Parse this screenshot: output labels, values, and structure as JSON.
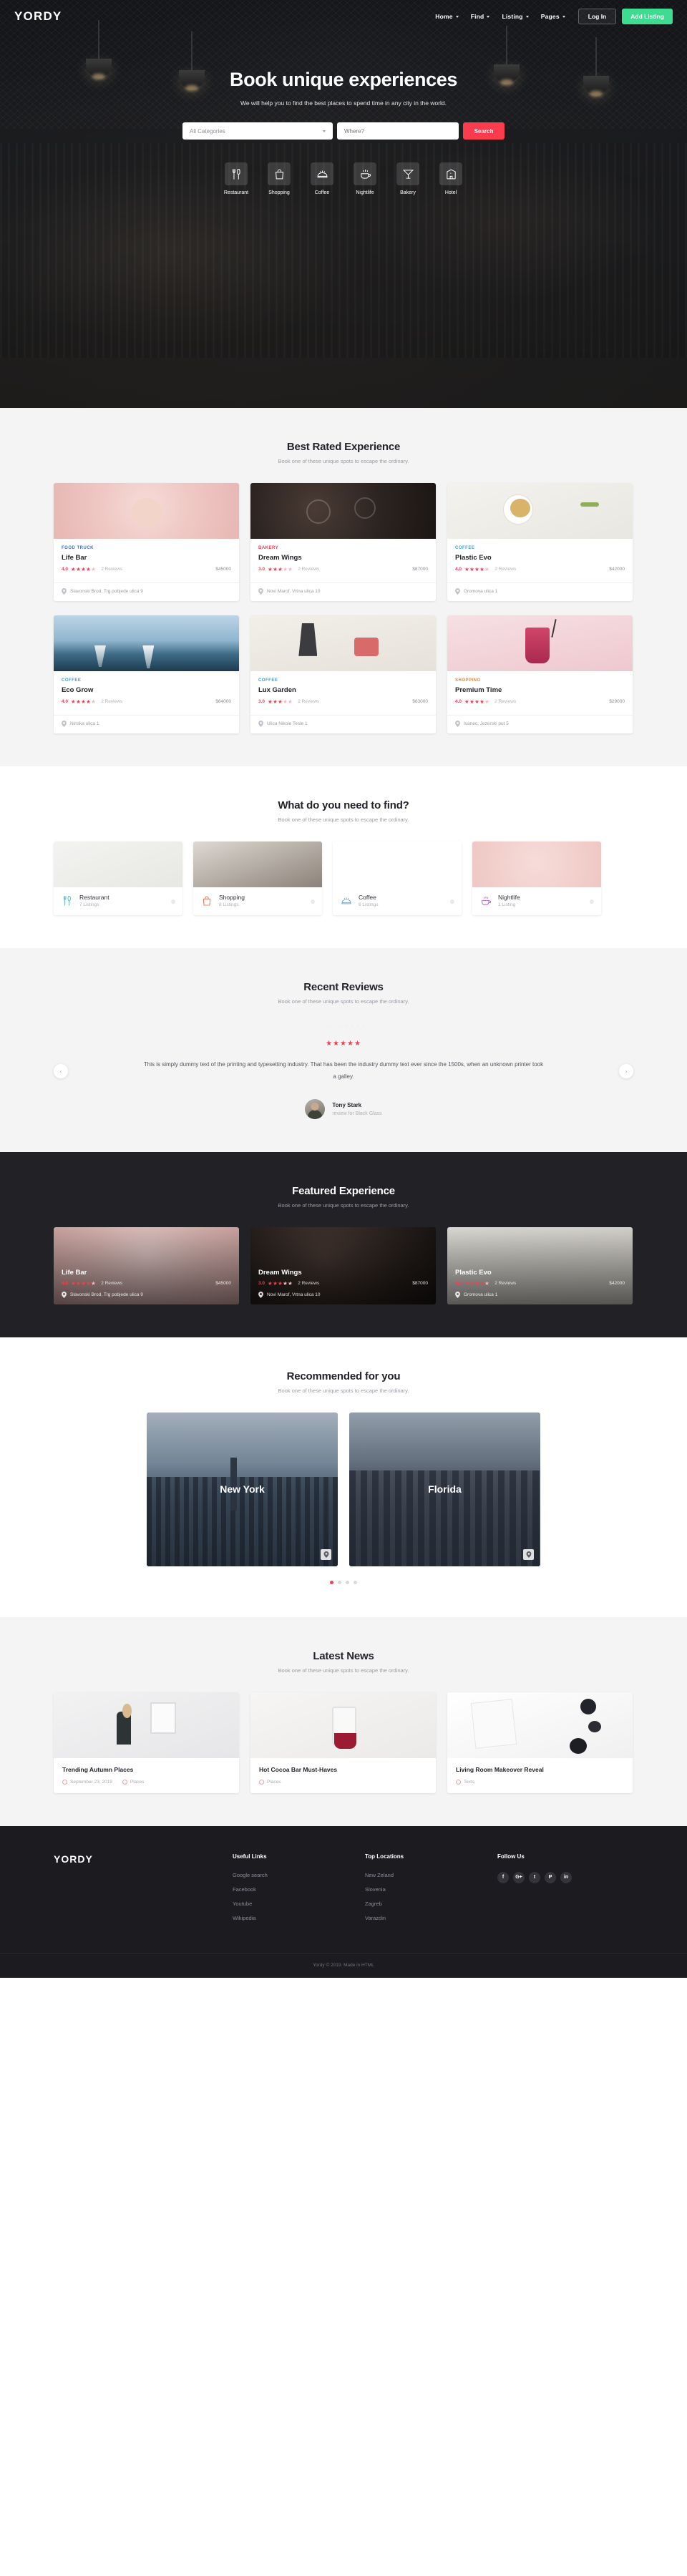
{
  "brand": {
    "name": "YORDY"
  },
  "nav": {
    "links": [
      {
        "label": "Home",
        "caret": true
      },
      {
        "label": "Find",
        "caret": true
      },
      {
        "label": "Listing",
        "caret": true
      },
      {
        "label": "Pages",
        "caret": true
      }
    ],
    "login_label": "Log In",
    "add_listing_label": "Add Listing",
    "accent_green": "#3ddc91"
  },
  "hero": {
    "title": "Book unique experiences",
    "subtitle": "We will help you to find the best places to spend time in any city in the world.",
    "search": {
      "category_value": "All Categories",
      "where_placeholder": "Where?",
      "where_value": "",
      "button_label": "Search",
      "button_color": "#fb3b4e"
    },
    "categories": [
      {
        "label": "Restaurant",
        "icon": "fork-knife-icon"
      },
      {
        "label": "Shopping",
        "icon": "shopping-bag-icon"
      },
      {
        "label": "Coffee",
        "icon": "sandwich-icon"
      },
      {
        "label": "Nightlife",
        "icon": "coffee-cup-icon"
      },
      {
        "label": "Bakery",
        "icon": "cocktail-glass-icon"
      },
      {
        "label": "Hotel",
        "icon": "hotel-building-icon"
      }
    ]
  },
  "best_rated": {
    "title": "Best Rated Experience",
    "subtitle": "Book one of these unique spots to escape the ordinary.",
    "cards": [
      {
        "category": "FOOD TRUCK",
        "category_color": "#3f6fd8",
        "name": "Life Bar",
        "rating": "4.0",
        "stars": 4,
        "reviews": "2 Reviews",
        "price": "$45000",
        "address": "Slavonski Brod, Trg pobjede ulica 9"
      },
      {
        "category": "BAKERY",
        "category_color": "#fb3b4e",
        "name": "Dream Wings",
        "rating": "3.0",
        "stars": 3,
        "reviews": "2 Reviews",
        "price": "$87000",
        "address": "Novi Marof, Vrtna ulica 10"
      },
      {
        "category": "COFFEE",
        "category_color": "#3f9fd8",
        "name": "Plastic Evo",
        "rating": "4.0",
        "stars": 4,
        "reviews": "2 Reviews",
        "price": "$42000",
        "address": "Gromova ulica 1"
      },
      {
        "category": "COFFEE",
        "category_color": "#3f9fd8",
        "name": "Eco Grow",
        "rating": "4.0",
        "stars": 4,
        "reviews": "2 Reviews",
        "price": "$64000",
        "address": "Ninska ulica 1"
      },
      {
        "category": "COFFEE",
        "category_color": "#3f9fd8",
        "name": "Lux Garden",
        "rating": "3.0",
        "stars": 3,
        "reviews": "2 Reviews",
        "price": "$63000",
        "address": "Ulica Nikole Tesle 1"
      },
      {
        "category": "SHOPPING",
        "category_color": "#e8883a",
        "name": "Premium Time",
        "rating": "4.0",
        "stars": 4,
        "reviews": "2 Reviews",
        "price": "$29000",
        "address": "Ivanec, Jezerski put 5"
      }
    ]
  },
  "need_find": {
    "title": "What do you need to find?",
    "subtitle": "Book one of these unique spots to escape the ordinary.",
    "cards": [
      {
        "name": "Restaurant",
        "count": "7 Listings",
        "icon": "fork-knife-icon",
        "color": "#3fb8b8"
      },
      {
        "name": "Shopping",
        "count": "8 Listings",
        "icon": "shopping-bag-icon",
        "color": "#e8663a"
      },
      {
        "name": "Coffee",
        "count": "6 Listings",
        "icon": "sandwich-icon",
        "color": "#4fa3de"
      },
      {
        "name": "Nightlife",
        "count": "1 Listing",
        "icon": "coffee-cup-icon",
        "color": "#a74fd4"
      }
    ]
  },
  "reviews": {
    "title": "Recent Reviews",
    "subtitle": "Book one of these unique spots to escape the ordinary.",
    "stars": 5,
    "text": "This is simply dummy text of the printing and typesetting industry. That has been the industry dummy text ever since the 1500s, when an unknown printer took a galley.",
    "author": "Tony Stark",
    "author_for": "review for Black Glass",
    "prev_icon": "chevron-left-icon",
    "next_icon": "chevron-right-icon"
  },
  "featured": {
    "title": "Featured Experience",
    "subtitle": "Book one of these unique spots to escape the ordinary.",
    "cards": [
      {
        "name": "Life Bar",
        "rating": "4.0",
        "stars": 4,
        "reviews": "2 Reviews",
        "price": "$45000",
        "address": "Slavonski Brod, Trg pobjede ulica 9"
      },
      {
        "name": "Dream Wings",
        "rating": "3.0",
        "stars": 3,
        "reviews": "2 Reviews",
        "price": "$87000",
        "address": "Novi Marof, Vrtna ulica 10"
      },
      {
        "name": "Plastic Evo",
        "rating": "4.0",
        "stars": 4,
        "reviews": "2 Reviews",
        "price": "$42000",
        "address": "Gromova ulica 1"
      }
    ]
  },
  "recommended": {
    "title": "Recommended for you",
    "subtitle": "Book one of these unique spots to escape the ordinary.",
    "cards": [
      {
        "title": "New York",
        "icon": "map-pin-icon"
      },
      {
        "title": "Florida",
        "icon": "map-pin-icon"
      }
    ],
    "dots": 4,
    "active_dot": 0
  },
  "news": {
    "title": "Latest News",
    "subtitle": "Book one of these unique spots to escape the ordinary.",
    "cards": [
      {
        "title": "Trending Autumn Places",
        "date": "September 23, 2019",
        "author": "Places"
      },
      {
        "title": "Hot Cocoa Bar Must-Haves",
        "date": "",
        "author": "Places"
      },
      {
        "title": "Living Room Makeover Reveal",
        "date": "",
        "author": "Texts"
      }
    ]
  },
  "footer": {
    "logo": "YORDY",
    "columns": [
      {
        "heading": "Useful Links",
        "items": [
          "Google search",
          "Facebook",
          "Youtube",
          "Wikipedia"
        ]
      },
      {
        "heading": "Top Locations",
        "items": [
          "New Zeland",
          "Slovenia",
          "Zagreb",
          "Varazdin"
        ]
      }
    ],
    "follow_heading": "Follow Us",
    "socials": [
      {
        "label": "f",
        "name": "facebook-icon"
      },
      {
        "label": "G+",
        "name": "google-plus-icon"
      },
      {
        "label": "t",
        "name": "twitter-icon"
      },
      {
        "label": "P",
        "name": "pinterest-icon"
      },
      {
        "label": "in",
        "name": "linkedin-icon"
      }
    ],
    "copyright": "Yordy © 2019. Made in HTML"
  }
}
